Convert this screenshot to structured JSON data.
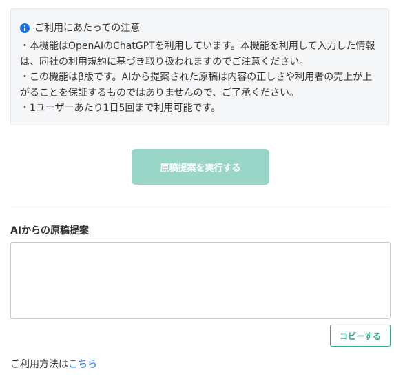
{
  "notice": {
    "icon": "info-icon",
    "title": "ご利用にあたっての注意",
    "lines": [
      "・本機能はOpenAIのChatGPTを利用しています。本機能を利用して入力した情報",
      "は、同社の利用規約に基づき取り扱われますのでご注意ください。",
      "・この機能はβ版です。AIから提案された原稿は内容の正しさや利用者の売上が上",
      "がることを保証するものではありませんので、ご了承ください。",
      "・1ユーザーあたり1日5回まで利用可能です。"
    ]
  },
  "run_button": {
    "label": "原稿提案を実行する",
    "state": "disabled"
  },
  "result": {
    "label": "AIからの原稿提案",
    "value": ""
  },
  "copy_button": {
    "label": "コピーする"
  },
  "usage": {
    "text": "ご利用方法は",
    "link_label": "こちら"
  },
  "colors": {
    "accent": "#2fa989",
    "button_disabled_bg": "#9ad6c8",
    "link": "#1a73e8",
    "info_icon": "#1a73e8",
    "notice_bg": "#f5f6f8"
  }
}
